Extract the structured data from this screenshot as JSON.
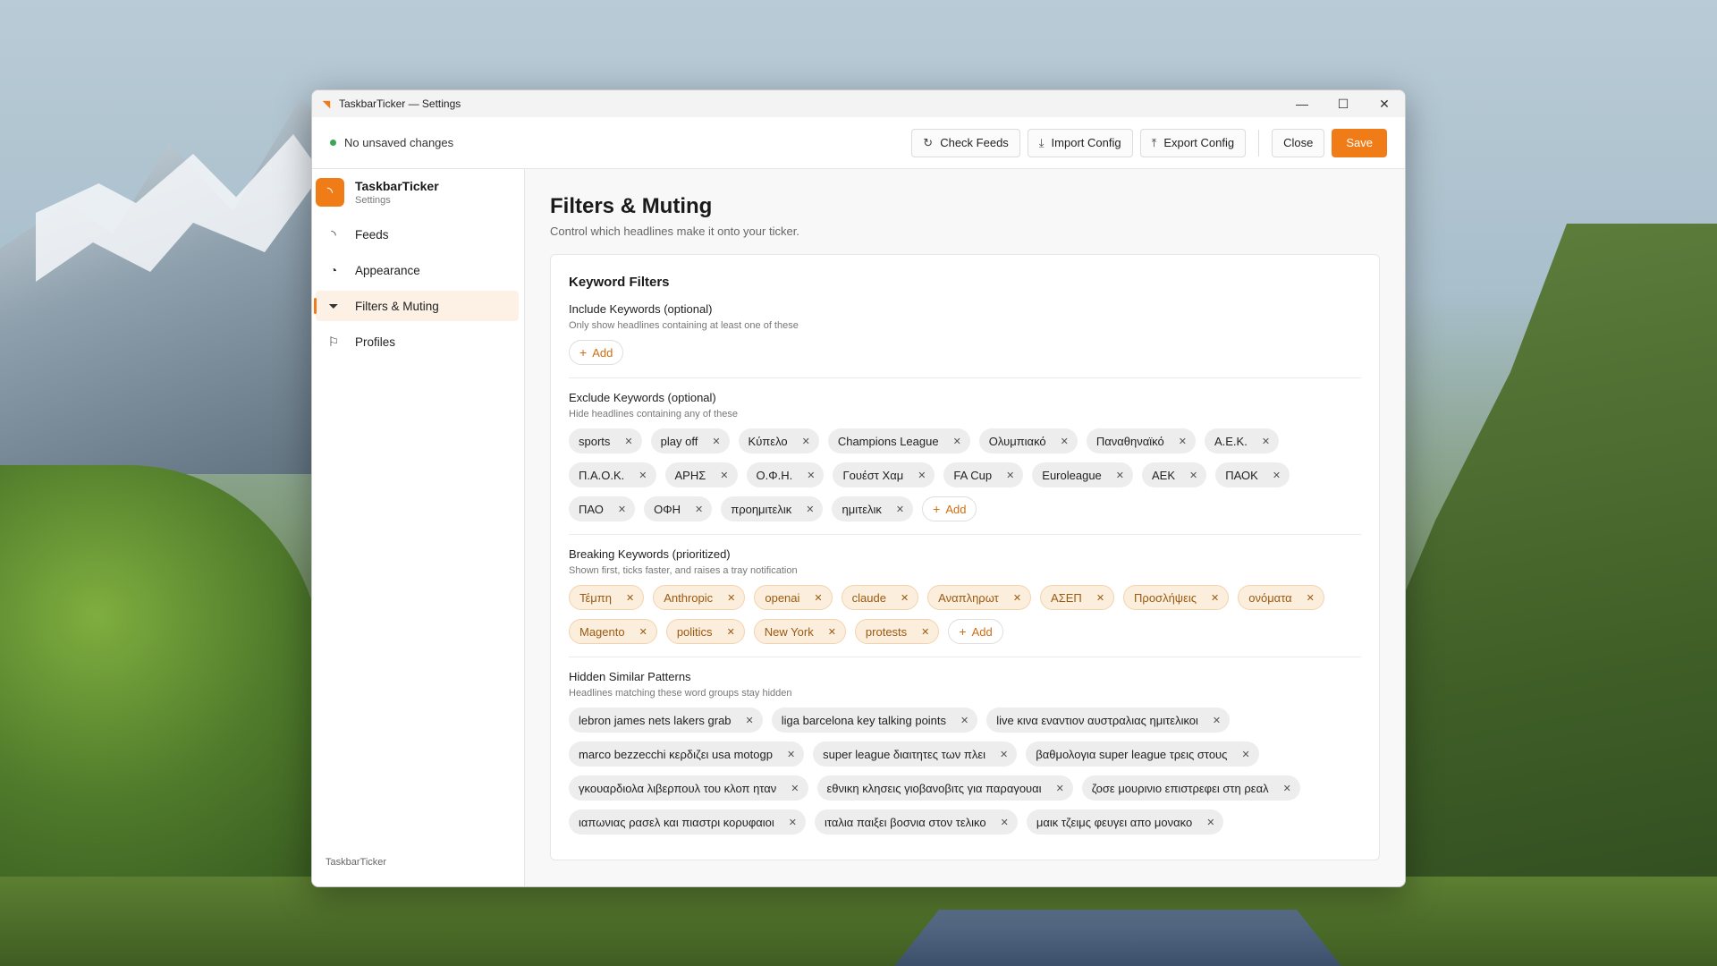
{
  "window": {
    "title": "TaskbarTicker — Settings"
  },
  "topbar": {
    "status": "No unsaved changes",
    "buttons": {
      "check_feeds": "Check Feeds",
      "import_config": "Import Config",
      "export_config": "Export Config",
      "close": "Close",
      "save": "Save"
    }
  },
  "sidebar": {
    "brand": {
      "name": "TaskbarTicker",
      "subtitle": "Settings"
    },
    "items": [
      {
        "label": "Feeds",
        "icon": "rss-icon"
      },
      {
        "label": "Appearance",
        "icon": "palette-icon"
      },
      {
        "label": "Filters & Muting",
        "icon": "filter-icon",
        "active": true
      },
      {
        "label": "Profiles",
        "icon": "bookmark-icon"
      }
    ],
    "footer": "TaskbarTicker"
  },
  "page": {
    "title": "Filters & Muting",
    "subtitle": "Control which headlines make it onto your ticker.",
    "card_title": "Keyword Filters",
    "add_label": "Add"
  },
  "include": {
    "label": "Include Keywords (optional)",
    "hint": "Only show headlines containing at least one of these",
    "chips": []
  },
  "exclude": {
    "label": "Exclude Keywords (optional)",
    "hint": "Hide headlines containing any of these",
    "chips": [
      "sports",
      "play off",
      "Κύπελο",
      "Champions League",
      "Ολυμπιακό",
      "Παναθηναϊκό",
      "Α.Ε.Κ.",
      "Π.Α.Ο.Κ.",
      "ΑΡΗΣ",
      "Ο.Φ.Η.",
      "Γουέστ Χαμ",
      "FA Cup",
      "Euroleague",
      "ΑΕΚ",
      "ΠΑΟΚ",
      "ΠΑΟ",
      "ΟΦΗ",
      "προημιτελικ",
      "ημιτελικ"
    ]
  },
  "breaking": {
    "label": "Breaking Keywords (prioritized)",
    "hint": "Shown first, ticks faster, and raises a tray notification",
    "chips": [
      "Τέμπη",
      "Anthropic",
      "openai",
      "claude",
      "Αναπληρωτ",
      "ΑΣΕΠ",
      "Προσλήψεις",
      "ονόματα",
      "Magento",
      "politics",
      "New York",
      "protests"
    ]
  },
  "hidden": {
    "label": "Hidden Similar Patterns",
    "hint": "Headlines matching these word groups stay hidden",
    "chips": [
      "lebron james nets lakers grab",
      "liga barcelona key talking points",
      "live κινα εναντιον αυστραλιας ημιτελικοι",
      "marco bezzecchi κερδιζει usa motogp",
      "super league διαιτητες των πλει",
      "βαθμολογια super league τρεις στους",
      "γκουαρδιολα λιβερπουλ του κλοπ ηταν",
      "εθνικη κλησεις γιοβανοβιτς για παραγουαι",
      "ζοσε μουρινιο επιστρεφει στη ρεαλ",
      "ιαπωνιας ρασελ και πιαστρι κορυφαιοι",
      "ιταλια παιξει βοσνια στον τελικο",
      "μαικ τζειμς φευγει απο μονακο"
    ]
  },
  "colors": {
    "accent": "#f07c17",
    "status_ok": "#3aa757"
  }
}
